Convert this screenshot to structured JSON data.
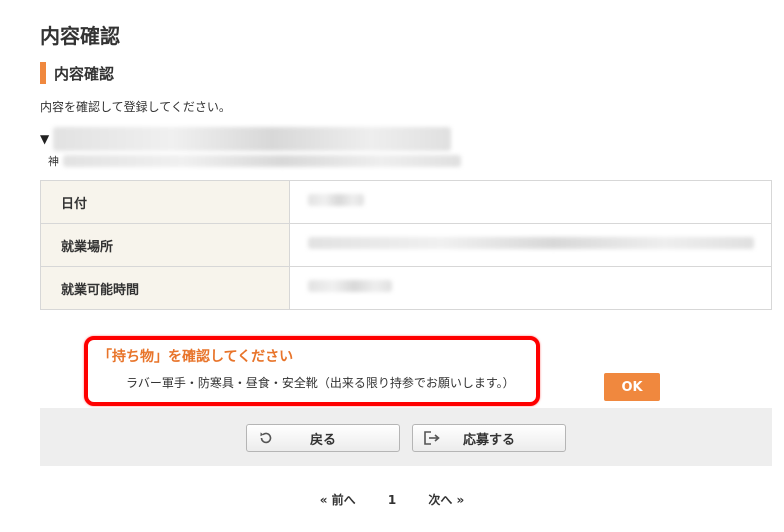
{
  "page": {
    "title": "内容確認"
  },
  "section": {
    "heading": "内容確認",
    "instruction": "内容を確認して登録してください。"
  },
  "job": {
    "title_marker": "▼",
    "sub_marker": "神"
  },
  "details": {
    "rows": [
      {
        "label": "日付"
      },
      {
        "label": "就業場所"
      },
      {
        "label": "就業可能時間"
      }
    ]
  },
  "notice": {
    "heading": "「持ち物」を確認してください",
    "body": "ラバー軍手・防寒具・昼食・安全靴（出来る限り持参でお願いします。）"
  },
  "buttons": {
    "ok": "OK",
    "back": "戻る",
    "apply": "応募する"
  },
  "pagination": {
    "prev": "« 前へ",
    "current": "1",
    "next": "次へ »"
  },
  "colors": {
    "accent": "#f0883e",
    "highlight_border": "#ff0000",
    "notice_heading": "#e8742a",
    "table_header_bg": "#f7f4ec"
  },
  "icons": {
    "back": "refresh-icon",
    "apply": "exit-arrow-icon"
  }
}
